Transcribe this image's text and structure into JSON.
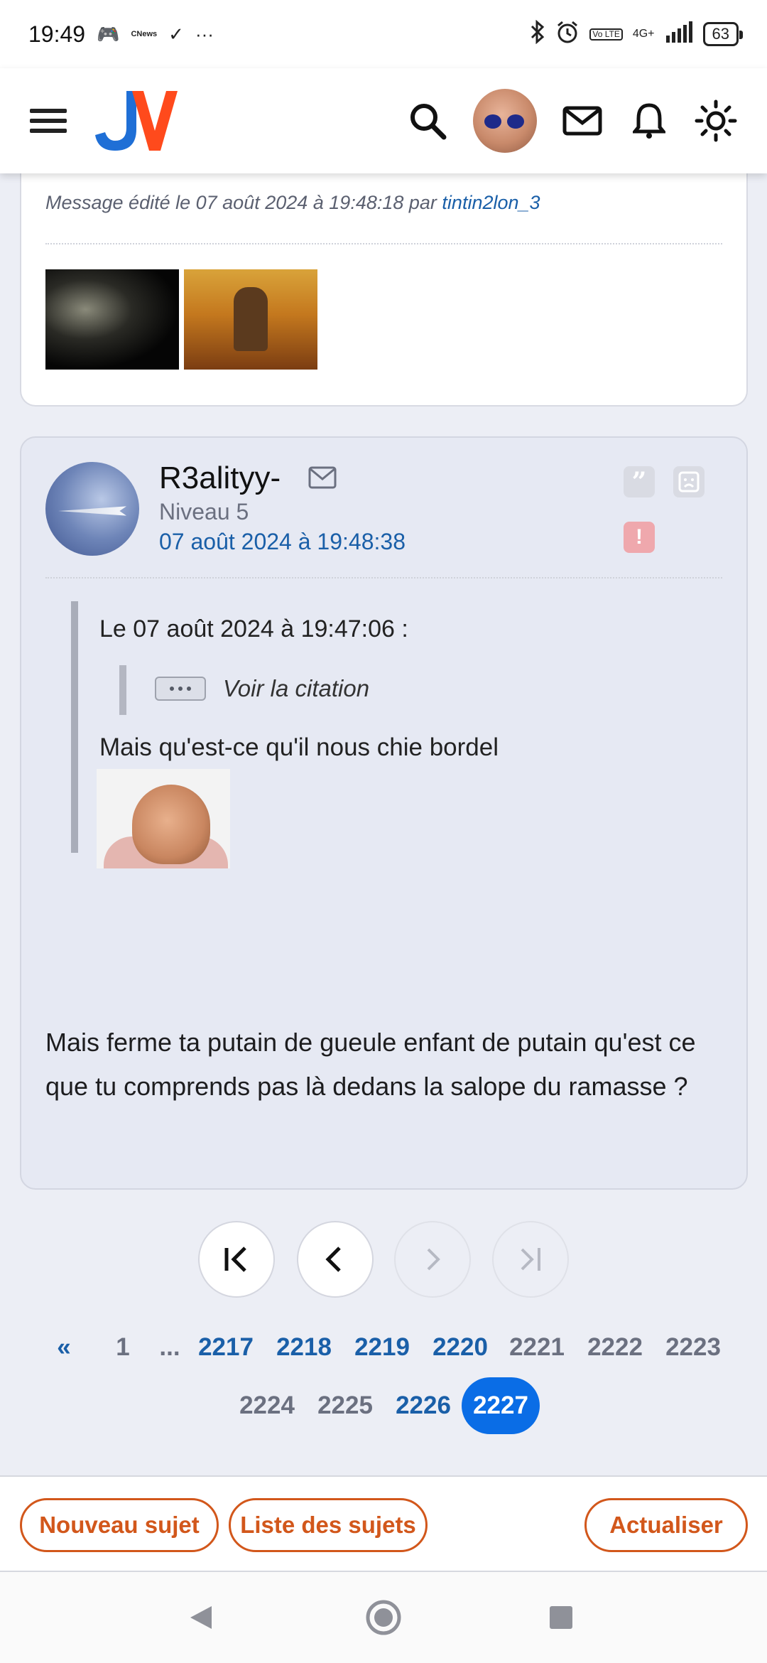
{
  "status_bar": {
    "time": "19:49",
    "notification_app": "CNews",
    "more": "···",
    "network": "4G+",
    "volte": "Vo LTE",
    "battery": "63"
  },
  "header": {
    "logo": "JV",
    "logo_colors": {
      "j": "#1f6fd6",
      "v": "#ff4a1c"
    }
  },
  "previous_post": {
    "edit_note_prefix": "Message édité le 07 août 2024 à 19:48:18 par ",
    "edit_author": "tintin2lon_3"
  },
  "post": {
    "author": "R3alityy-",
    "level": "Niveau 5",
    "date": "07 août 2024 à 19:48:38",
    "quote_header": "Le 07 août 2024 à 19:47:06 :",
    "see_quote": "Voir la citation",
    "quote_text": "Mais qu'est-ce qu'il nous chie bordel",
    "body": "Mais ferme ta putain de gueule enfant de putain qu'est ce que tu comprends pas là dedans la salope du ramasse ?"
  },
  "pagination": {
    "prev_all": "«",
    "first": "1",
    "ellipsis": "...",
    "row1_links": [
      "2217",
      "2218",
      "2219",
      "2220"
    ],
    "row1_plain": [
      "2221",
      "2222",
      "2223"
    ],
    "row2_plain": [
      "2224",
      "2225"
    ],
    "row2_link": "2226",
    "current": "2227"
  },
  "actions": {
    "new_topic": "Nouveau sujet",
    "topic_list": "Liste des sujets",
    "refresh": "Actualiser"
  },
  "colors": {
    "accent": "#1a5fa8",
    "current_page": "#0a6de6",
    "action_orange": "#d2571b",
    "alert_pink": "#efa8ad"
  }
}
